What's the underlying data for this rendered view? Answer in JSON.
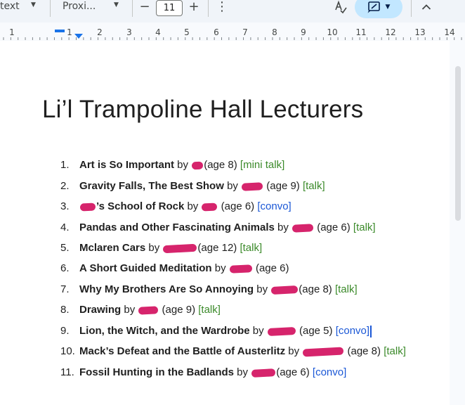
{
  "toolbar": {
    "style_label": "text",
    "font_label": "Proxi...",
    "font_size": "11",
    "decrease": "−",
    "increase": "+",
    "more": "⋮"
  },
  "ruler": {
    "marks": [
      "1",
      "1",
      "2",
      "3",
      "4",
      "5",
      "6",
      "7",
      "8",
      "9",
      "10",
      "11",
      "12",
      "13",
      "14"
    ]
  },
  "document": {
    "title": "Li’l Trampoline Hall Lecturers",
    "items": [
      {
        "num": "1.",
        "title": "Art is So Important",
        "by": " by ",
        "age": "(age 8)",
        "tag": "[mini talk]",
        "tag_type": "green"
      },
      {
        "num": "2.",
        "title": "Gravity Falls, The Best Show",
        "by": " by ",
        "age": " (age 9)",
        "tag": "[talk]",
        "tag_type": "green"
      },
      {
        "num": "3.",
        "title": "’s School of Rock",
        "by": " by ",
        "age": " (age 6)",
        "tag": "[convo]",
        "tag_type": "blue"
      },
      {
        "num": "4.",
        "title": "Pandas and Other Fascinating Animals",
        "by": " by ",
        "age": " (age 6)",
        "tag": "[talk]",
        "tag_type": "green"
      },
      {
        "num": "5.",
        "title": "Mclaren Cars",
        "by": " by ",
        "age": "(age 12)",
        "tag": "[talk]",
        "tag_type": "green"
      },
      {
        "num": "6.",
        "title": "A Short Guided Meditation",
        "by": " by ",
        "age": " (age 6)",
        "tag": "",
        "tag_type": "none"
      },
      {
        "num": "7.",
        "title": "Why My Brothers Are So Annoying",
        "by": " by ",
        "age": "(age 8)",
        "tag": "[talk]",
        "tag_type": "green"
      },
      {
        "num": "8.",
        "title": "Drawing",
        "by": " by ",
        "age": " (age 9)",
        "tag": "[talk]",
        "tag_type": "green"
      },
      {
        "num": "9.",
        "title": "Lion, the Witch, and the Wardrobe",
        "by": " by ",
        "age": " (age 5)",
        "tag": "[convo]",
        "tag_type": "blue"
      },
      {
        "num": "10.",
        "title": "Mack’s Defeat and the Battle of Austerlitz",
        "by": " by ",
        "age": " (age 8)",
        "tag": "[talk]",
        "tag_type": "green"
      },
      {
        "num": "11.",
        "title": "Fossil Hunting in the Badlands",
        "by": " by ",
        "age": "(age 6)",
        "tag": "[convo]",
        "tag_type": "blue"
      }
    ]
  },
  "colors": {
    "redaction": "#d6246c",
    "talk_tag": "#3b8a2a",
    "convo_tag": "#1a57d6",
    "active_pill": "#c2e7ff"
  },
  "icons": [
    "dropdown-caret-icon",
    "spellcheck-icon",
    "suggest-edits-icon",
    "chevron-up-icon",
    "more-vert-icon"
  ]
}
